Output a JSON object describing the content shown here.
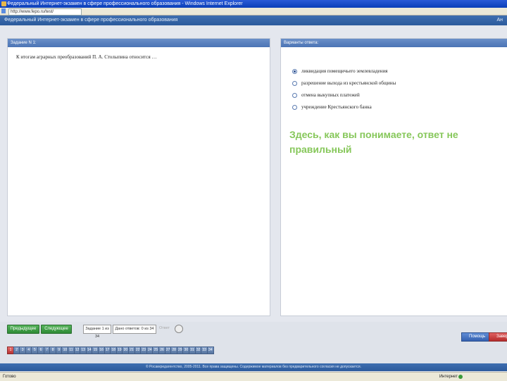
{
  "window": {
    "title": "Федеральный Интернет-экзамен в сфере профессионального образования - Windows Internet Explorer"
  },
  "address_bar": {
    "url": "http://www.fepo.ru/test/"
  },
  "app_header": {
    "title": "Федеральный Интернет-экзамен в сфере профессионального образования",
    "right_label": "Ан"
  },
  "task_panel": {
    "header": "Задание N 1:",
    "question": "К итогам аграрных преобразований П. А. Столыпина относится …"
  },
  "answers_panel": {
    "header": "Варианты ответа:",
    "options": [
      {
        "label": "ликвидация помещичьего землевладения",
        "selected": true
      },
      {
        "label": "разрешение выхода из крестьянской общины",
        "selected": false
      },
      {
        "label": "отмена выкупных платежей",
        "selected": false
      },
      {
        "label": "учреждение Крестьянского банка",
        "selected": false
      }
    ]
  },
  "annotation": "Здесь, как вы понимаете, ответ не правильный",
  "navigation": {
    "prev_label": "Предыдущее",
    "next_label": "Следующее",
    "task_counter": "Задание 1 из 34",
    "answered_counter": "Дано ответов: 0 из 34",
    "grey_label": "Ответ"
  },
  "buttons": {
    "help_label": "Помощь",
    "finish_label": "Завершить"
  },
  "pager": {
    "pages": [
      "1",
      "2",
      "3",
      "4",
      "5",
      "6",
      "7",
      "8",
      "9",
      "10",
      "11",
      "12",
      "13",
      "14",
      "15",
      "16",
      "17",
      "18",
      "19",
      "20",
      "21",
      "22",
      "23",
      "24",
      "25",
      "26",
      "27",
      "28",
      "29",
      "30",
      "31",
      "32",
      "33",
      "34"
    ],
    "current": "1"
  },
  "footer": {
    "text": "© Росаккредагентство, 2005-2011. Все права защищены. Содержимое материалов без предварительного согласия не допускается."
  },
  "status_bar": {
    "left": "Готово",
    "right": "Интернет"
  }
}
